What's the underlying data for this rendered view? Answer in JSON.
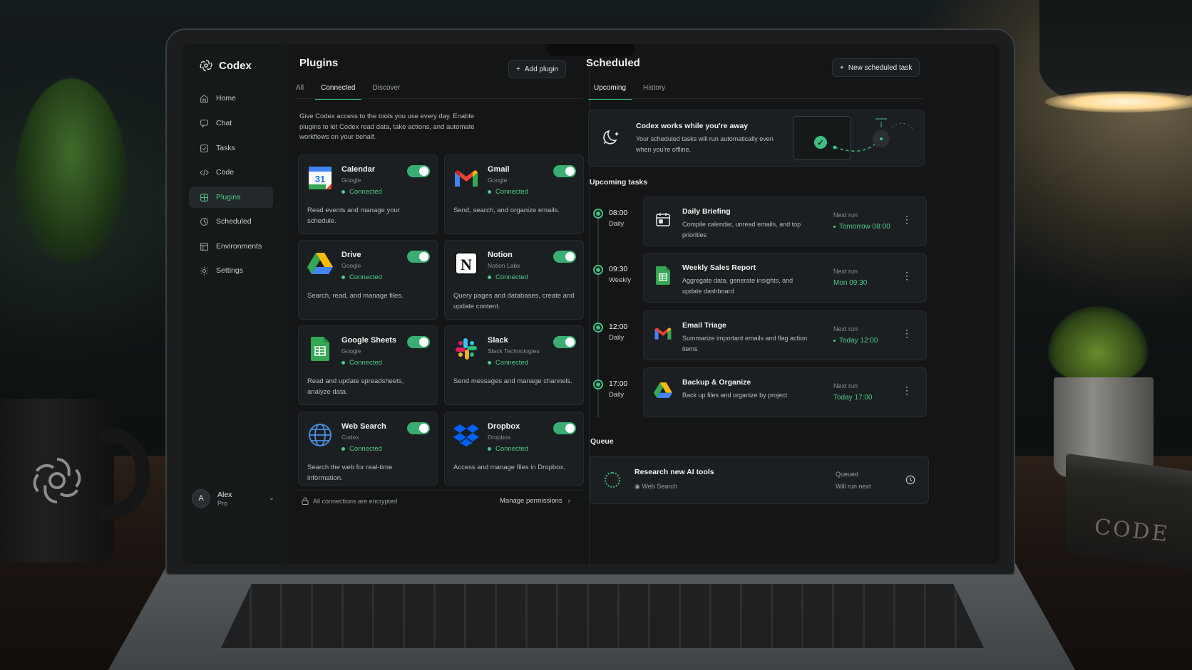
{
  "app": {
    "name": "Codex"
  },
  "sidebar": {
    "items": [
      {
        "label": "Home",
        "icon": "home-icon"
      },
      {
        "label": "Chat",
        "icon": "chat-icon"
      },
      {
        "label": "Tasks",
        "icon": "tasks-icon"
      },
      {
        "label": "Code",
        "icon": "code-icon"
      },
      {
        "label": "Plugins",
        "icon": "plugins-icon",
        "active": true
      },
      {
        "label": "Scheduled",
        "icon": "clock-icon"
      },
      {
        "label": "Environments",
        "icon": "environments-icon"
      },
      {
        "label": "Settings",
        "icon": "gear-icon"
      }
    ],
    "user": {
      "initial": "A",
      "name": "Alex",
      "plan": "Pro"
    }
  },
  "plugins": {
    "title": "Plugins",
    "add_label": "Add plugin",
    "tabs": [
      "All",
      "Connected",
      "Discover"
    ],
    "active_tab": "Connected",
    "description": "Give Codex access to the tools you use every day. Enable plugins to let Codex read data, take actions, and automate workflows on your behalf.",
    "cards": [
      {
        "name": "Calendar",
        "vendor": "Google",
        "status": "Connected",
        "desc": "Read events and manage your schedule.",
        "icon": "google-calendar-icon"
      },
      {
        "name": "Gmail",
        "vendor": "Google",
        "status": "Connected",
        "desc": "Send, search, and organize emails.",
        "icon": "gmail-icon"
      },
      {
        "name": "Drive",
        "vendor": "Google",
        "status": "Connected",
        "desc": "Search, read, and manage files.",
        "icon": "google-drive-icon"
      },
      {
        "name": "Notion",
        "vendor": "Notion Labs",
        "status": "Connected",
        "desc": "Query pages and databases, create and update content.",
        "icon": "notion-icon"
      },
      {
        "name": "Google Sheets",
        "vendor": "Google",
        "status": "Connected",
        "desc": "Read and update spreadsheets, analyze data.",
        "icon": "google-sheets-icon"
      },
      {
        "name": "Slack",
        "vendor": "Slack Technologies",
        "status": "Connected",
        "desc": "Send messages and manage channels.",
        "icon": "slack-icon"
      },
      {
        "name": "Web Search",
        "vendor": "Codex",
        "status": "Connected",
        "desc": "Search the web for real-time information.",
        "icon": "globe-icon"
      },
      {
        "name": "Dropbox",
        "vendor": "Dropbox",
        "status": "Connected",
        "desc": "Access and manage files in Dropbox.",
        "icon": "dropbox-icon"
      }
    ],
    "footer_note": "All connections are encrypted",
    "manage_label": "Manage permissions"
  },
  "scheduled": {
    "title": "Scheduled",
    "new_label": "New scheduled task",
    "tabs": [
      "Upcoming",
      "History"
    ],
    "active_tab": "Upcoming",
    "hero": {
      "title": "Codex works while you're away",
      "text": "Your scheduled tasks will run automatically even when you're offline."
    },
    "upcoming_label": "Upcoming tasks",
    "tasks": [
      {
        "time": "08:00",
        "freq": "Daily",
        "name": "Daily Briefing",
        "desc": "Compile calendar, unread emails, and top priorities",
        "next_label": "Next run",
        "next": "Tomorrow 08:00",
        "icon": "calendar-icon"
      },
      {
        "time": "09:30",
        "freq": "Weekly",
        "name": "Weekly Sales Report",
        "desc": "Aggregate data, generate insights, and update dashboard",
        "next_label": "Next run",
        "next": "Mon 09:30",
        "icon": "google-sheets-icon"
      },
      {
        "time": "12:00",
        "freq": "Daily",
        "name": "Email Triage",
        "desc": "Summarize important emails and flag action items",
        "next_label": "Next run",
        "next": "Today 12:00",
        "icon": "gmail-icon"
      },
      {
        "time": "17:00",
        "freq": "Daily",
        "name": "Backup & Organize",
        "desc": "Back up files and organize by project",
        "next_label": "Next run",
        "next": "Today 17:00",
        "icon": "google-drive-icon"
      }
    ],
    "queue_label": "Queue",
    "queue": {
      "name": "Research new AI tools",
      "sub": "Web Search",
      "status": "Queued",
      "note": "Will run next"
    }
  },
  "decor": {
    "book_title": "CODE"
  },
  "colors": {
    "accent": "#3fbf80",
    "bg": "#131516",
    "card": "#1b1f21"
  }
}
